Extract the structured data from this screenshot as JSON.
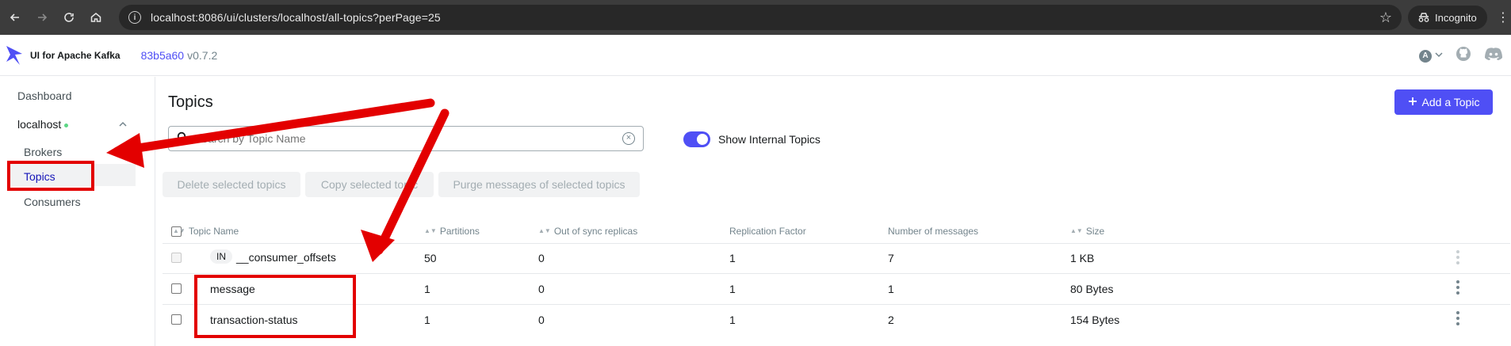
{
  "browser": {
    "url": "localhost:8086/ui/clusters/localhost/all-topics?perPage=25",
    "incognito_label": "Incognito"
  },
  "app": {
    "brand": "UI for Apache Kafka",
    "commit": "83b5a60",
    "version": "v0.7.2",
    "avatar_initial": "A"
  },
  "sidebar": {
    "dashboard": "Dashboard",
    "cluster": "localhost",
    "items": [
      "Brokers",
      "Topics",
      "Consumers"
    ],
    "active": "Topics"
  },
  "page": {
    "title": "Topics",
    "add_topic_label": "Add a Topic",
    "search_placeholder": "Search by Topic Name",
    "toggle_label": "Show Internal Topics",
    "toggle_on": true,
    "bulk_actions": [
      "Delete selected topics",
      "Copy selected topic",
      "Purge messages of selected topics"
    ]
  },
  "table": {
    "columns": [
      "Topic Name",
      "Partitions",
      "Out of sync replicas",
      "Replication Factor",
      "Number of messages",
      "Size"
    ],
    "rows": [
      {
        "internal_badge": "IN",
        "name": "__consumer_offsets",
        "partitions": "50",
        "out_of_sync": "0",
        "replication": "1",
        "messages": "7",
        "size": "1 KB"
      },
      {
        "name": "message",
        "partitions": "1",
        "out_of_sync": "0",
        "replication": "1",
        "messages": "1",
        "size": "80 Bytes"
      },
      {
        "name": "transaction-status",
        "partitions": "1",
        "out_of_sync": "0",
        "replication": "1",
        "messages": "2",
        "size": "154 Bytes"
      }
    ]
  },
  "colors": {
    "accent": "#4f4ff5",
    "annotation": "#e30000"
  }
}
